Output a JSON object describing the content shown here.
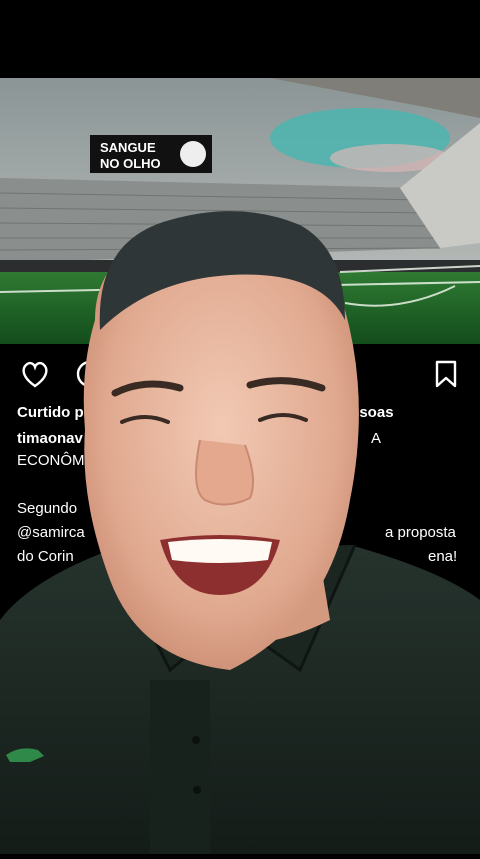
{
  "billboard": {
    "line1": "SANGUE",
    "line2": "NO OLHO"
  },
  "post": {
    "liked_prefix": "Curtido p",
    "liked_suffix": "ssoas",
    "caption_user": "timaonav",
    "caption_tail_1": "A",
    "caption_line2": "ECONÔM",
    "para_start": "Segundo",
    "mention": "@samirca",
    "mention_tail": "a proposta",
    "line_corin": "do Corin",
    "line_corin_tail": "ena!"
  },
  "icons": [
    "heart-icon",
    "comment-icon",
    "bookmark-icon"
  ],
  "colors": {
    "background": "#000000",
    "text": "#ffffff",
    "pitch": "#1e6b2a",
    "shirt": "#1f2b26"
  }
}
